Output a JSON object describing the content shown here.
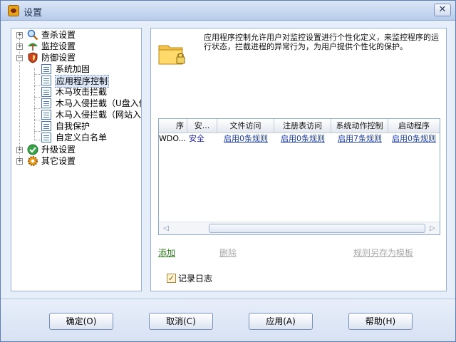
{
  "window": {
    "title": "设置",
    "close_symbol": "✕"
  },
  "tree": {
    "items": [
      {
        "label": "查杀设置",
        "expander": "+",
        "icon": "magnifier-icon"
      },
      {
        "label": "监控设置",
        "expander": "+",
        "icon": "umbrella-icon"
      },
      {
        "label": "防御设置",
        "expander": "−",
        "icon": "shield-icon",
        "children": [
          {
            "label": "系统加固"
          },
          {
            "label": "应用程序控制",
            "selected": true
          },
          {
            "label": "木马攻击拦截"
          },
          {
            "label": "木马入侵拦截（U盘入侵"
          },
          {
            "label": "木马入侵拦截（网站入侵"
          },
          {
            "label": "自我保护"
          },
          {
            "label": "自定义白名单"
          }
        ]
      },
      {
        "label": "升级设置",
        "expander": "+",
        "icon": "green-check-icon"
      },
      {
        "label": "其它设置",
        "expander": "+",
        "icon": "gear-icon"
      }
    ]
  },
  "main": {
    "description": "应用程序控制允许用户对监控设置进行个性化定义，来监控程序的运行状态，拦截进程的异常行为，为用户提供个性化的保护。",
    "table": {
      "headers": [
        "序",
        "安...",
        "文件访问",
        "注册表访问",
        "系统动作控制",
        "启动程序"
      ],
      "rows": [
        [
          "WDO...",
          "安全",
          "启用0条规则",
          "启用0条规则",
          "启用7条规则",
          "启用0条规则"
        ]
      ]
    },
    "scroll_left": "◁",
    "scroll_right": "▷",
    "add_label": "添加",
    "delete_label": "删除",
    "save_template_label": "规则另存为模板",
    "log_label": "记录日志",
    "log_checked": "✓"
  },
  "buttons": {
    "ok": "确定(O)",
    "cancel": "取消(C)",
    "apply": "应用(A)",
    "help": "帮助(H)"
  }
}
